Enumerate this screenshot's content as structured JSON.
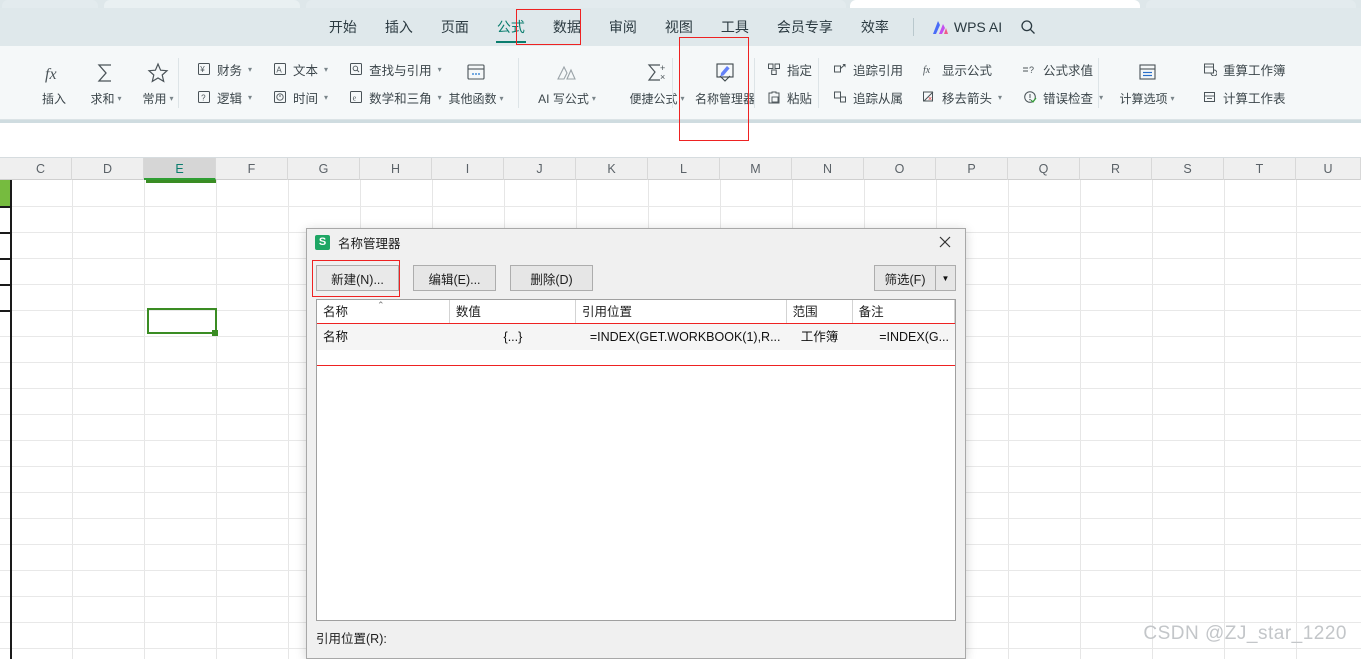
{
  "menubar": {
    "items": [
      {
        "label": "开始",
        "active": false
      },
      {
        "label": "插入",
        "active": false
      },
      {
        "label": "页面",
        "active": false
      },
      {
        "label": "公式",
        "active": true
      },
      {
        "label": "数据",
        "active": false
      },
      {
        "label": "审阅",
        "active": false
      },
      {
        "label": "视图",
        "active": false
      },
      {
        "label": "工具",
        "active": false
      },
      {
        "label": "会员专享",
        "active": false
      },
      {
        "label": "效率",
        "active": false
      }
    ],
    "ai_label": "WPS AI",
    "search_icon": "search-icon"
  },
  "ribbon": {
    "big_buttons": [
      {
        "label": "插入",
        "icon": "fx-icon",
        "caret": false
      },
      {
        "label": "求和",
        "icon": "sigma-icon",
        "caret": true
      },
      {
        "label": "常用",
        "icon": "star-icon",
        "caret": true
      }
    ],
    "function_groups": [
      {
        "label": "财务",
        "icon": "finance-icon",
        "caret": true
      },
      {
        "label": "文本",
        "icon": "text-icon",
        "caret": true
      },
      {
        "label": "查找与引用",
        "icon": "lookup-icon",
        "caret": true
      },
      {
        "label": "逻辑",
        "icon": "logic-icon",
        "caret": true
      },
      {
        "label": "时间",
        "icon": "clock-icon",
        "caret": true
      },
      {
        "label": "数学和三角",
        "icon": "math-icon",
        "caret": true
      }
    ],
    "other_func": {
      "label": "其他函数",
      "icon": "more-functions-icon",
      "caret": true
    },
    "ai_formula": {
      "label": "AI 写公式",
      "icon": "ai-formula-icon",
      "caret": true
    },
    "quick_formula": {
      "label": "便捷公式",
      "icon": "quick-formula-icon",
      "caret": true
    },
    "name_manager": {
      "label": "名称管理器",
      "icon": "name-manager-icon"
    },
    "assign": {
      "label": "指定",
      "icon": "assign-icon"
    },
    "paste_name": {
      "label": "粘贴",
      "icon": "paste-name-icon"
    },
    "audit": [
      {
        "label": "追踪引用",
        "icon": "trace-precedents-icon",
        "caret": false
      },
      {
        "label": "显示公式",
        "icon": "show-formulas-icon",
        "caret": false
      },
      {
        "label": "公式求值",
        "icon": "evaluate-formula-icon",
        "caret": false
      },
      {
        "label": "追踪从属",
        "icon": "trace-dependents-icon",
        "caret": false
      },
      {
        "label": "移去箭头",
        "icon": "remove-arrows-icon",
        "caret": true
      },
      {
        "label": "错误检查",
        "icon": "error-check-icon",
        "caret": true
      }
    ],
    "calc_options": {
      "label": "计算选项",
      "icon": "calc-options-icon",
      "caret": true
    },
    "recalc_book": {
      "label": "重算工作簿",
      "icon": "recalc-workbook-icon"
    },
    "calc_sheet": {
      "label": "计算工作表",
      "icon": "calc-sheet-icon"
    }
  },
  "sheet": {
    "columns": [
      "C",
      "D",
      "E",
      "F",
      "G",
      "H",
      "I",
      "J",
      "K",
      "L",
      "M",
      "N",
      "O",
      "P",
      "Q",
      "R",
      "S",
      "T",
      "U"
    ],
    "selected_column": "E",
    "watermark": "CSDN @ZJ_star_1220"
  },
  "dialog": {
    "title": "名称管理器",
    "icon": "wps-sheet-icon",
    "close_icon": "close-icon",
    "buttons": {
      "new": "新建(N)...",
      "edit": "编辑(E)...",
      "delete": "删除(D)",
      "filter": "筛选(F)",
      "filter_caret": "chevron-down-icon"
    },
    "table": {
      "headers": [
        "名称",
        "数值",
        "引用位置",
        "范围",
        "备注"
      ],
      "sort_indicator": "sort-asc-icon",
      "rows": [
        {
          "name": "名称",
          "value": "{...}",
          "refers_to": "=INDEX(GET.WORKBOOK(1),R...",
          "scope": "工作簿",
          "note": "=INDEX(G..."
        }
      ]
    },
    "footer_label": "引用位置(R):"
  },
  "colors": {
    "accent": "#0a7d6e",
    "highlight_red": "#ee2222",
    "selection_green": "#3a8c23",
    "menubar_bg": "#dfe8eb",
    "ribbon_bg": "#f5f8f9"
  }
}
